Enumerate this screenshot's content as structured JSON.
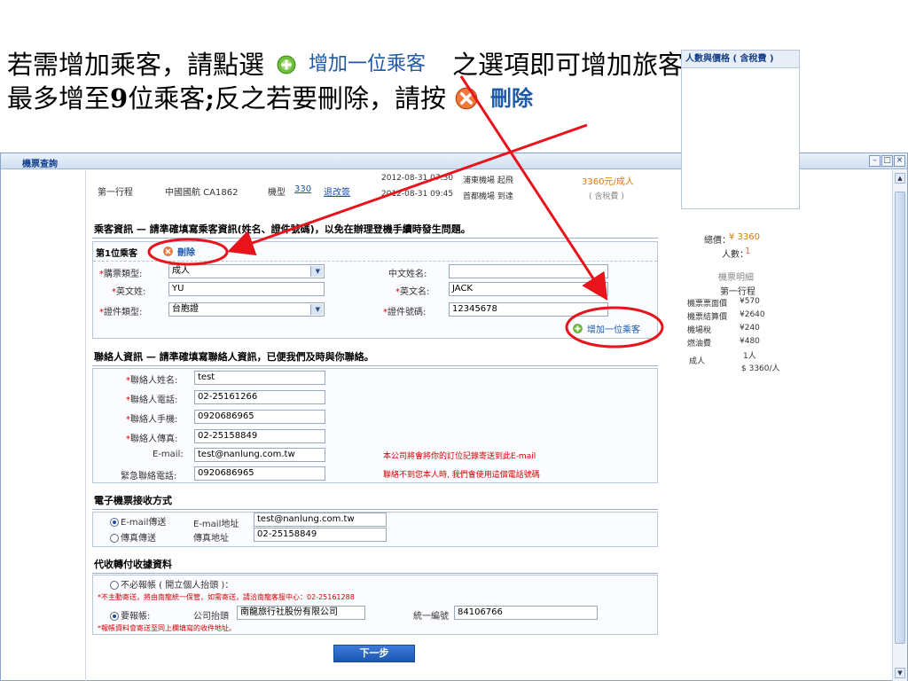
{
  "caption": {
    "line1_a": "若需增加乘客，請點選",
    "line1_btn": "增加一位乘客",
    "line1_b": "之選項即可增加旅客人數，",
    "line2_a": "最多增至",
    "line2_num": "9",
    "line2_b": "位乘客",
    "line2_semi": ";",
    "line2_c": "反之若要刪除，請按",
    "line2_btn": "刪除"
  },
  "window": {
    "title": "機票查詢",
    "min": "–",
    "max": "□",
    "close": "×"
  },
  "flight": {
    "label": "第一行程",
    "airline": "中國國航 CA1862",
    "aircraft_label": "機型",
    "aircraft": "330",
    "rules": "退改簽",
    "dep_time": "2012-08-31 07:30",
    "dep_place": "浦東機場 起飛",
    "arr_time": "2012-08-31 09:45",
    "arr_place": "首都機場 到達",
    "price": "3360元/成人",
    "tax_note": "( 含稅費 )"
  },
  "passenger_section": {
    "title": "乘客資訊 — 請準確填寫乘客資訊(姓名、證件號碼)，以免在辦理登機手續時發生問題。",
    "p1_label": "第1位乘客",
    "delete_label": "刪除",
    "ticket_type_label": "購票類型:",
    "ticket_type": "成人",
    "surname_label": "英文姓:",
    "surname": "YU",
    "id_type_label": "證件類型:",
    "id_type": "台胞證",
    "cn_name_label": "中文姓名:",
    "cn_name": "",
    "given_label": "英文名:",
    "given": "JACK",
    "id_no_label": "證件號碼:",
    "id_no": "12345678",
    "add_label": "增加一位乘客"
  },
  "contact_section": {
    "title": "聯絡人資訊 — 請準確填寫聯絡人資訊，已便我們及時與你聯絡。",
    "name_label": "聯絡人姓名:",
    "name": "test",
    "phone_label": "聯絡人電話:",
    "phone": "02-25161266",
    "mobile_label": "聯絡人手機:",
    "mobile": "0920686965",
    "fax_label": "聯絡人傳真:",
    "fax": "02-25158849",
    "email_label": "E-mail:",
    "email": "test@nanlung.com.tw",
    "emerg_label": "緊急聯絡電話:",
    "emerg": "0920686965",
    "note1": "本公司將會將你的訂位記錄寄送到此E-mail",
    "note2": "聯絡不到您本人時, 我們會使用這個電話號碼"
  },
  "eticket_section": {
    "title": "電子機票接收方式",
    "opt_email": "E-mail傳送",
    "email_addr_label": "E-mail地址",
    "email_addr": "test@nanlung.com.tw",
    "opt_fax": "傳真傳送",
    "fax_no_label": "傳真地址",
    "fax_no": "02-25158849"
  },
  "receipt_section": {
    "title": "代收轉付收據資料",
    "opt_none": "不必報帳 ( 開立個人抬頭 )：",
    "note_none": "*不主動寄送，將由南龍統一保管，如需寄送，請洽南龍客服中心：02-25161288",
    "opt_need": "要報帳:",
    "company_label": "公司抬頭",
    "company": "南龍旅行社股份有限公司",
    "taxid_label": "統一編號",
    "taxid": "84106766",
    "note_need": "*報帳資料會寄送至同上欄填寫的收件地址。"
  },
  "next_button": "下一步",
  "summary": {
    "title": "人數與價格 ( 含稅費 )",
    "total_label": "總價：",
    "total": "¥ 3360",
    "count_label": "人數：",
    "count": "1",
    "detail_title": "機票明細",
    "trip": "第一行程",
    "face_label": "機票票面價",
    "face": "¥570",
    "settle_label": "機票結算價",
    "settle": "¥2640",
    "airport_label": "機場稅",
    "airport": "¥240",
    "fuel_label": "燃油費",
    "fuel": "¥480",
    "adult_label": "成人",
    "adult_count": "1人",
    "adult_price": "$ 3360/人"
  },
  "colors": {
    "annotation": "#e8141c",
    "accent": "#1e5aa8",
    "price": "#e07a00",
    "note": "#d40000"
  }
}
